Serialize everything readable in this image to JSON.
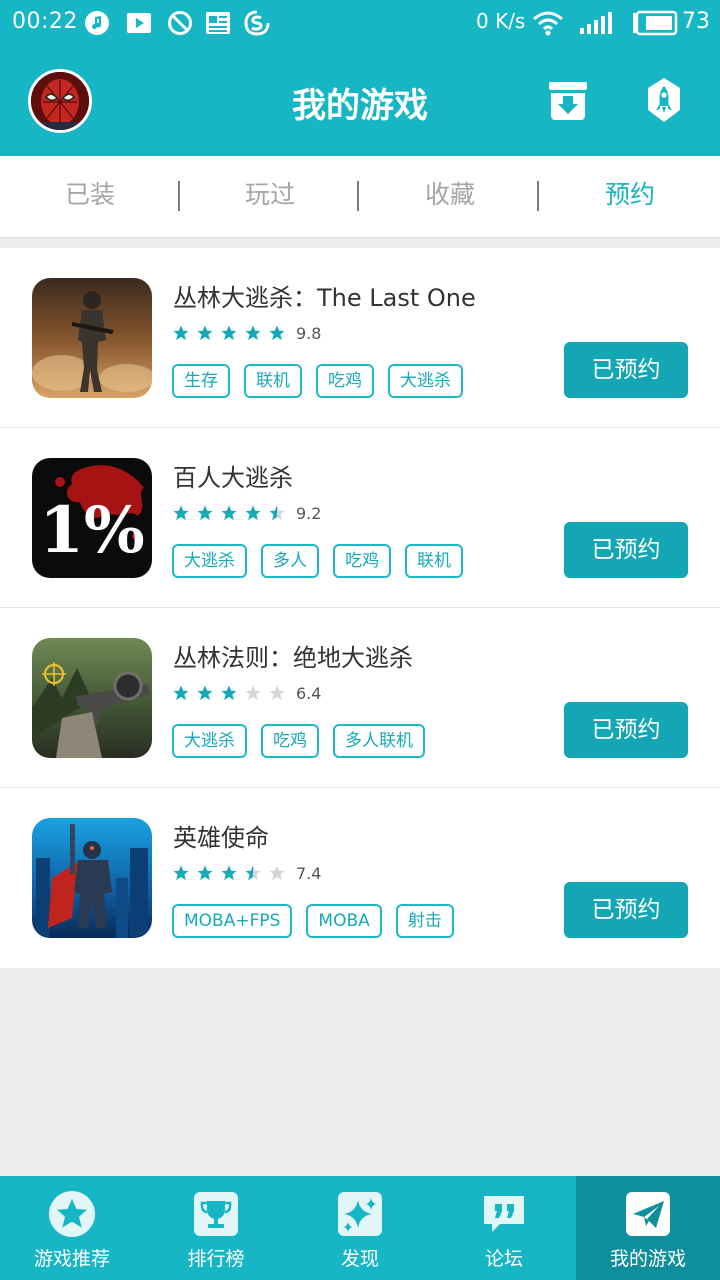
{
  "status_bar": {
    "time": "00:22",
    "speed": "0 K/s",
    "battery": "73"
  },
  "header": {
    "title": "我的游戏"
  },
  "tabs": [
    {
      "label": "已装",
      "active": false
    },
    {
      "label": "玩过",
      "active": false
    },
    {
      "label": "收藏",
      "active": false
    },
    {
      "label": "预约",
      "active": true
    }
  ],
  "games": [
    {
      "name": "丛林大逃杀：The Last One",
      "rating": "9.8",
      "stars": 5,
      "tags": [
        "生存",
        "联机",
        "吃鸡",
        "大逃杀"
      ],
      "button": "已预约",
      "icon": "soldier-game-icon"
    },
    {
      "name": "百人大逃杀",
      "rating": "9.2",
      "stars": 4.5,
      "tags": [
        "大逃杀",
        "多人",
        "吃鸡",
        "联机"
      ],
      "button": "已预约",
      "icon": "one-percent-game-icon",
      "icon_text": "1%"
    },
    {
      "name": "丛林法则：绝地大逃杀",
      "rating": "6.4",
      "stars": 3,
      "tags": [
        "大逃杀",
        "吃鸡",
        "多人联机"
      ],
      "button": "已预约",
      "icon": "sniper-game-icon"
    },
    {
      "name": "英雄使命",
      "rating": "7.4",
      "stars": 3.5,
      "tags": [
        "MOBA+FPS",
        "MOBA",
        "射击"
      ],
      "button": "已预约",
      "icon": "hero-game-icon"
    }
  ],
  "bottom_nav": [
    {
      "label": "游戏推荐",
      "icon": "star-icon",
      "active": false
    },
    {
      "label": "排行榜",
      "icon": "trophy-icon",
      "active": false
    },
    {
      "label": "发现",
      "icon": "sparkle-icon",
      "active": false
    },
    {
      "label": "论坛",
      "icon": "quote-bubble-icon",
      "active": false
    },
    {
      "label": "我的游戏",
      "icon": "paper-plane-icon",
      "active": true
    }
  ],
  "colors": {
    "primary": "#16b6c4",
    "button": "#14a6b4",
    "active_nav": "#0f8f9b",
    "star_on": "#14aab9",
    "star_off": "#d6d6d6"
  }
}
